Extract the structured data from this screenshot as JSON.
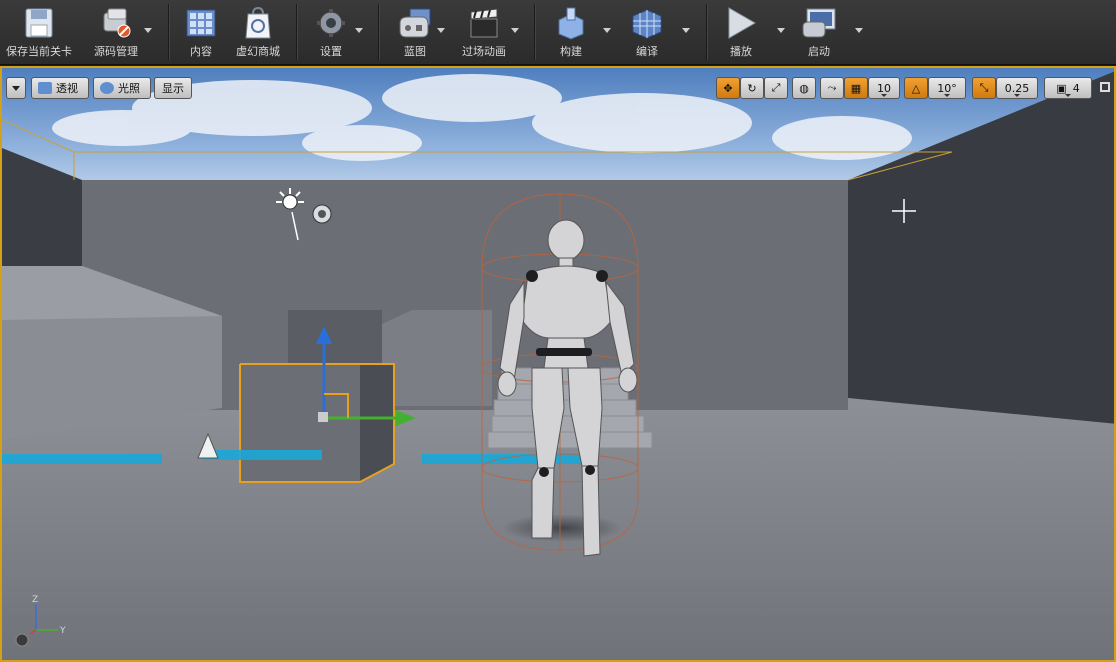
{
  "toolbar": {
    "items": [
      {
        "label": "保存当前关卡",
        "icon": "save-icon"
      },
      {
        "label": "源码管理",
        "icon": "source-control-icon"
      },
      {
        "label": "内容",
        "icon": "content-icon"
      },
      {
        "label": "虚幻商城",
        "icon": "marketplace-icon"
      },
      {
        "label": "设置",
        "icon": "settings-icon"
      },
      {
        "label": "蓝图",
        "icon": "blueprint-icon"
      },
      {
        "label": "过场动画",
        "icon": "cinematics-icon"
      },
      {
        "label": "构建",
        "icon": "build-icon"
      },
      {
        "label": "编译",
        "icon": "compile-icon"
      },
      {
        "label": "播放",
        "icon": "play-icon"
      },
      {
        "label": "启动",
        "icon": "launch-icon"
      }
    ]
  },
  "viewport": {
    "perspective_label": "透视",
    "lit_label": "光照",
    "show_label": "显示",
    "grid_snap_value": "10",
    "rotation_snap_value": "10°",
    "scale_snap_value": "0.25",
    "camera_speed_value": "4",
    "axis_labels": {
      "z": "Z",
      "y": "Y"
    },
    "colors": {
      "selection": "#d4a018",
      "snap_active": "#e08a1c",
      "sky": "#5f8fc8"
    }
  }
}
